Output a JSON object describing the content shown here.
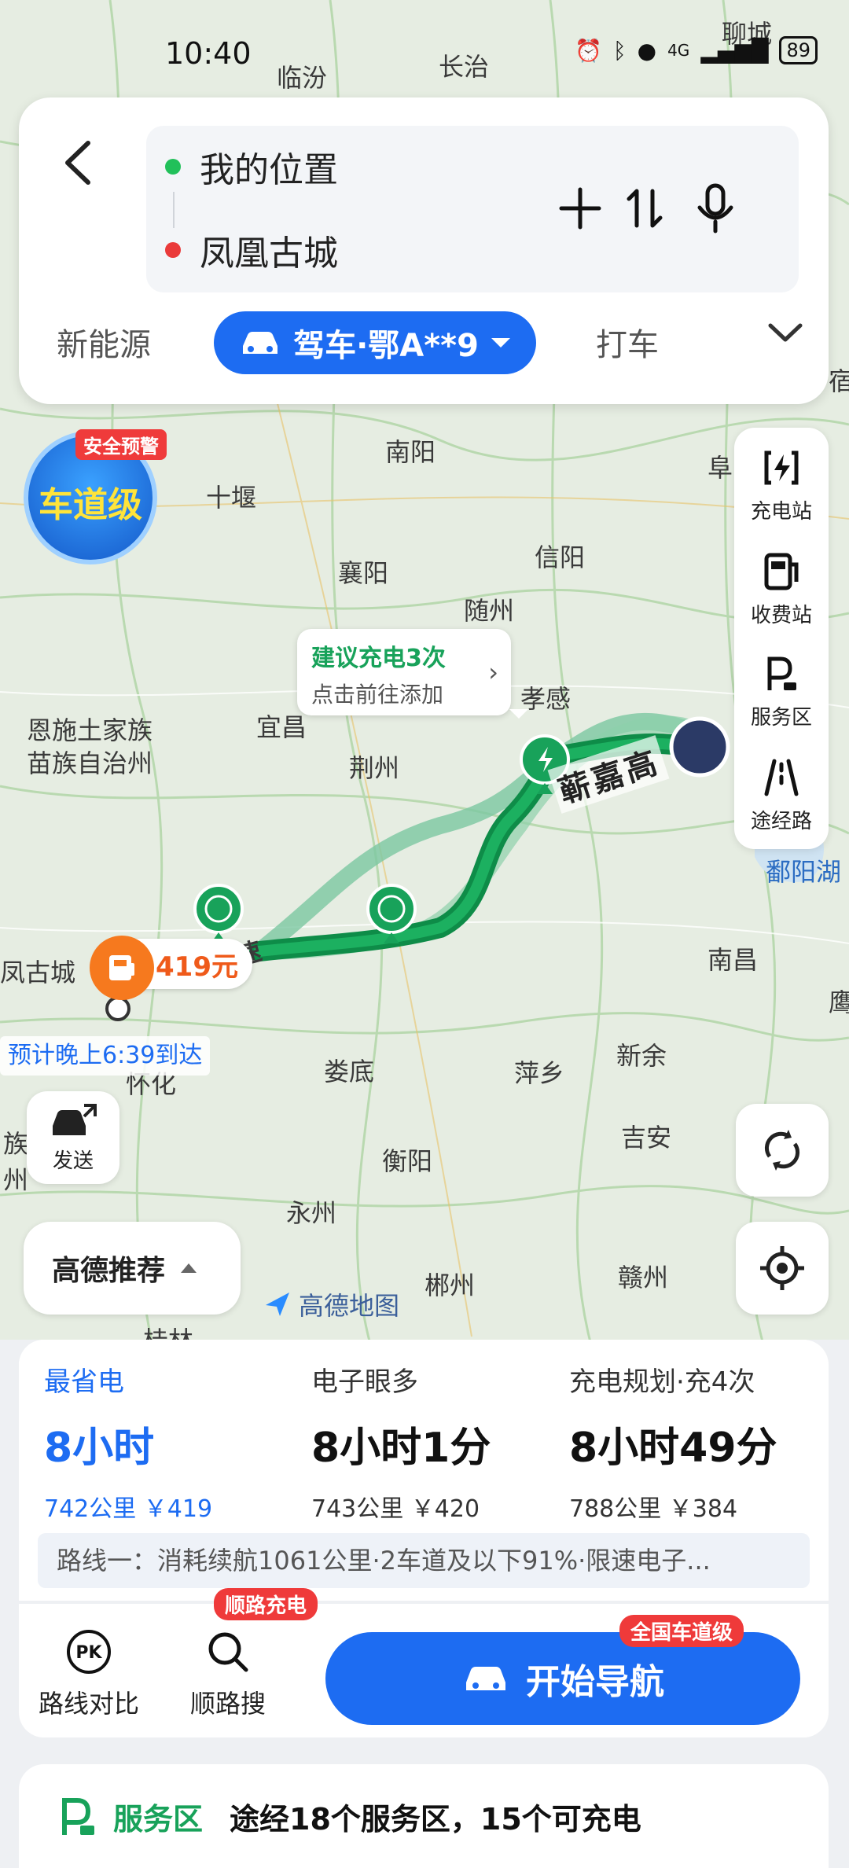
{
  "status": {
    "time": "10:40",
    "network": "4G",
    "battery": "89"
  },
  "search": {
    "origin": "我的位置",
    "destination": "凤凰古城"
  },
  "modes": {
    "left": "新能源",
    "selected": "驾车·鄂A**9",
    "right": "打车"
  },
  "badge": {
    "tag": "安全预警",
    "text": "车道级"
  },
  "tools": [
    {
      "label": "充电站",
      "icon": "charging-station-icon"
    },
    {
      "label": "收费站",
      "icon": "toll-station-icon"
    },
    {
      "label": "服务区",
      "icon": "service-area-icon"
    },
    {
      "label": "途经路",
      "icon": "via-road-icon"
    }
  ],
  "map": {
    "cities": [
      "聊城",
      "长治",
      "临汾",
      "南阳",
      "十堰",
      "襄阳",
      "信阳",
      "随州",
      "孝感",
      "宜昌",
      "荆州",
      "恩施土家族",
      "苗族自治州",
      "南昌",
      "新余",
      "萍乡",
      "娄底",
      "吉安",
      "衡阳",
      "永州",
      "郴州",
      "赣州",
      "怀化",
      "鄱阳湖",
      "凤古城",
      "桂林",
      "阜",
      "宿",
      "鹰",
      "族",
      "州"
    ],
    "tooltip": {
      "title": "建议充电3次",
      "subtitle": "点击前往添加"
    },
    "road": "蕲嘉高",
    "road_fragment": "速",
    "toll": "419元",
    "eta": "预计晚上6:39到达",
    "watermark": "高德地图"
  },
  "buttons": {
    "send": "发送",
    "recommend": "高德推荐"
  },
  "routes": [
    {
      "tag": "最省电",
      "duration": "8小时",
      "meta": "742公里 ￥419"
    },
    {
      "tag": "电子眼多",
      "duration": "8小时1分",
      "meta": "743公里 ￥420"
    },
    {
      "tag": "充电规划·充4次",
      "duration": "8小时49分",
      "meta": "788公里 ￥384"
    }
  ],
  "route_desc": "路线一：消耗续航1061公里·2车道及以下91%·限速电子...",
  "actions": {
    "compare": "路线对比",
    "search_along": "顺路搜",
    "search_badge": "顺路充电",
    "start": "开始导航",
    "start_badge": "全国车道级"
  },
  "service": {
    "title": "服务区",
    "desc": "途经18个服务区，15个可充电"
  },
  "colors": {
    "accent": "#1d6cf2",
    "route": "#16a15a",
    "danger": "#ef3a3a"
  }
}
